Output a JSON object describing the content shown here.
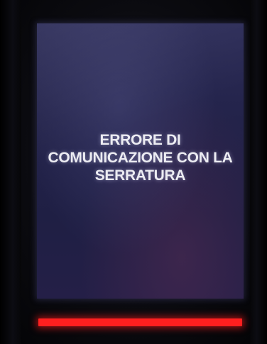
{
  "display": {
    "message_lines": [
      "ERRORE DI",
      "COMUNICAZIONE CON LA",
      "SERRATURA"
    ]
  },
  "status_led": {
    "color": "#ff1f1f",
    "state": "error"
  },
  "colors": {
    "screen_background": "#23234a",
    "text": "#ececf2"
  }
}
